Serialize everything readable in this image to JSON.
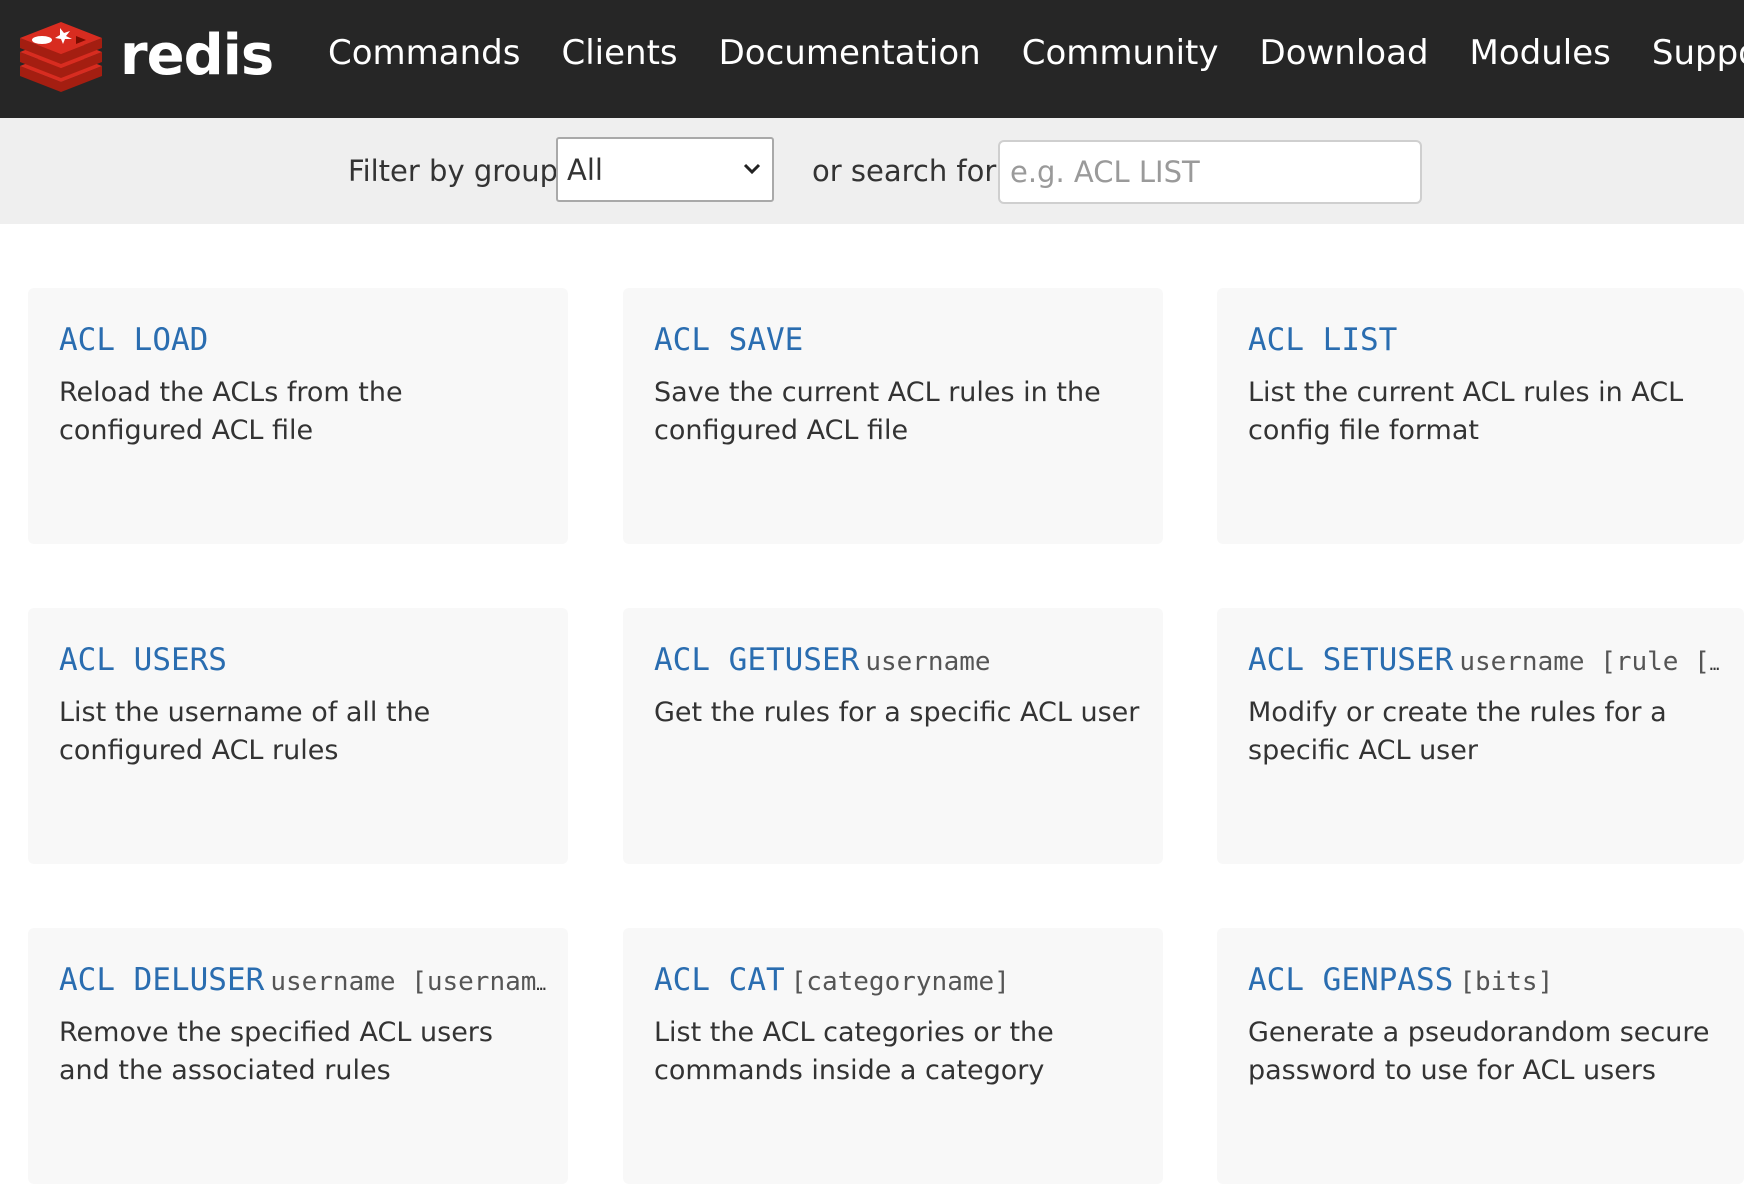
{
  "brand": {
    "name": "redis"
  },
  "nav": {
    "items": [
      "Commands",
      "Clients",
      "Documentation",
      "Community",
      "Download",
      "Modules",
      "Support"
    ]
  },
  "filter": {
    "group_label": "Filter by group:",
    "group_selected": "All",
    "search_label": "or search for:",
    "search_placeholder": "e.g. ACL LIST",
    "search_value": ""
  },
  "commands": [
    {
      "name": "ACL LOAD",
      "args": "",
      "desc": "Reload the ACLs from the configured ACL file"
    },
    {
      "name": "ACL SAVE",
      "args": "",
      "desc": "Save the current ACL rules in the configured ACL file"
    },
    {
      "name": "ACL LIST",
      "args": "",
      "desc": "List the current ACL rules in ACL config file format"
    },
    {
      "name": "ACL USERS",
      "args": "",
      "desc": "List the username of all the configured ACL rules"
    },
    {
      "name": "ACL GETUSER",
      "args": "username",
      "desc": "Get the rules for a specific ACL user"
    },
    {
      "name": "ACL SETUSER",
      "args": "username [rule [r…",
      "desc": "Modify or create the rules for a specific ACL user"
    },
    {
      "name": "ACL DELUSER",
      "args": "username [usernam…",
      "desc": "Remove the specified ACL users and the associated rules"
    },
    {
      "name": "ACL CAT",
      "args": "[categoryname]",
      "desc": "List the ACL categories or the commands inside a category"
    },
    {
      "name": "ACL GENPASS",
      "args": "[bits]",
      "desc": "Generate a pseudorandom secure password to use for ACL users"
    }
  ],
  "colors": {
    "header_bg": "#262626",
    "filter_bg": "#efefef",
    "card_bg": "#f8f8f8",
    "command_link": "#2a6db0",
    "logo_red": "#d82c20"
  }
}
